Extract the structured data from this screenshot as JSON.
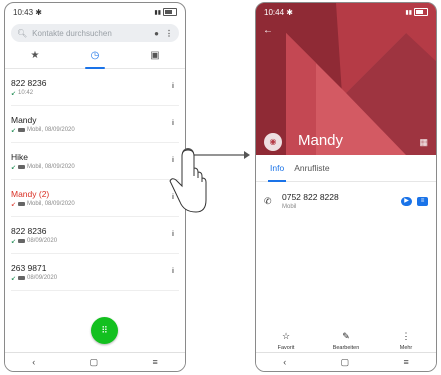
{
  "left": {
    "status_time": "10:43",
    "search_placeholder": "Kontakte durchsuchen",
    "calls": [
      {
        "name": "822 8236",
        "detail": "10:42",
        "missed": false
      },
      {
        "name": "Mandy",
        "detail": "Mobil, 08/09/2020",
        "missed": false
      },
      {
        "name": "Hike",
        "detail": "Mobil, 08/09/2020",
        "missed": false
      },
      {
        "name": "Mandy (2)",
        "detail": "Mobil, 08/09/2020",
        "missed": true
      },
      {
        "name": "822 8236",
        "detail": "08/09/2020",
        "missed": false
      },
      {
        "name": "263 9871",
        "detail": "08/09/2020",
        "missed": false
      }
    ],
    "info_glyph": "i",
    "dial_glyph": "⠿"
  },
  "right": {
    "status_time": "10:44",
    "contact_name": "Mandy",
    "tabs": [
      "Info",
      "Anrufliste"
    ],
    "phone_number": "0752 822 8228",
    "phone_label": "Mobil",
    "actions": [
      "Favorit",
      "Bearbeiten",
      "Mehr"
    ]
  },
  "icons": {
    "nav": [
      "back-icon",
      "home-icon",
      "recents-icon"
    ],
    "tabs": [
      "star-icon",
      "clock-icon",
      "contacts-icon"
    ]
  },
  "colors": {
    "accent": "#1a73e8",
    "fab": "#13c01f",
    "hero": "#b53b46",
    "missed": "#d93025"
  }
}
